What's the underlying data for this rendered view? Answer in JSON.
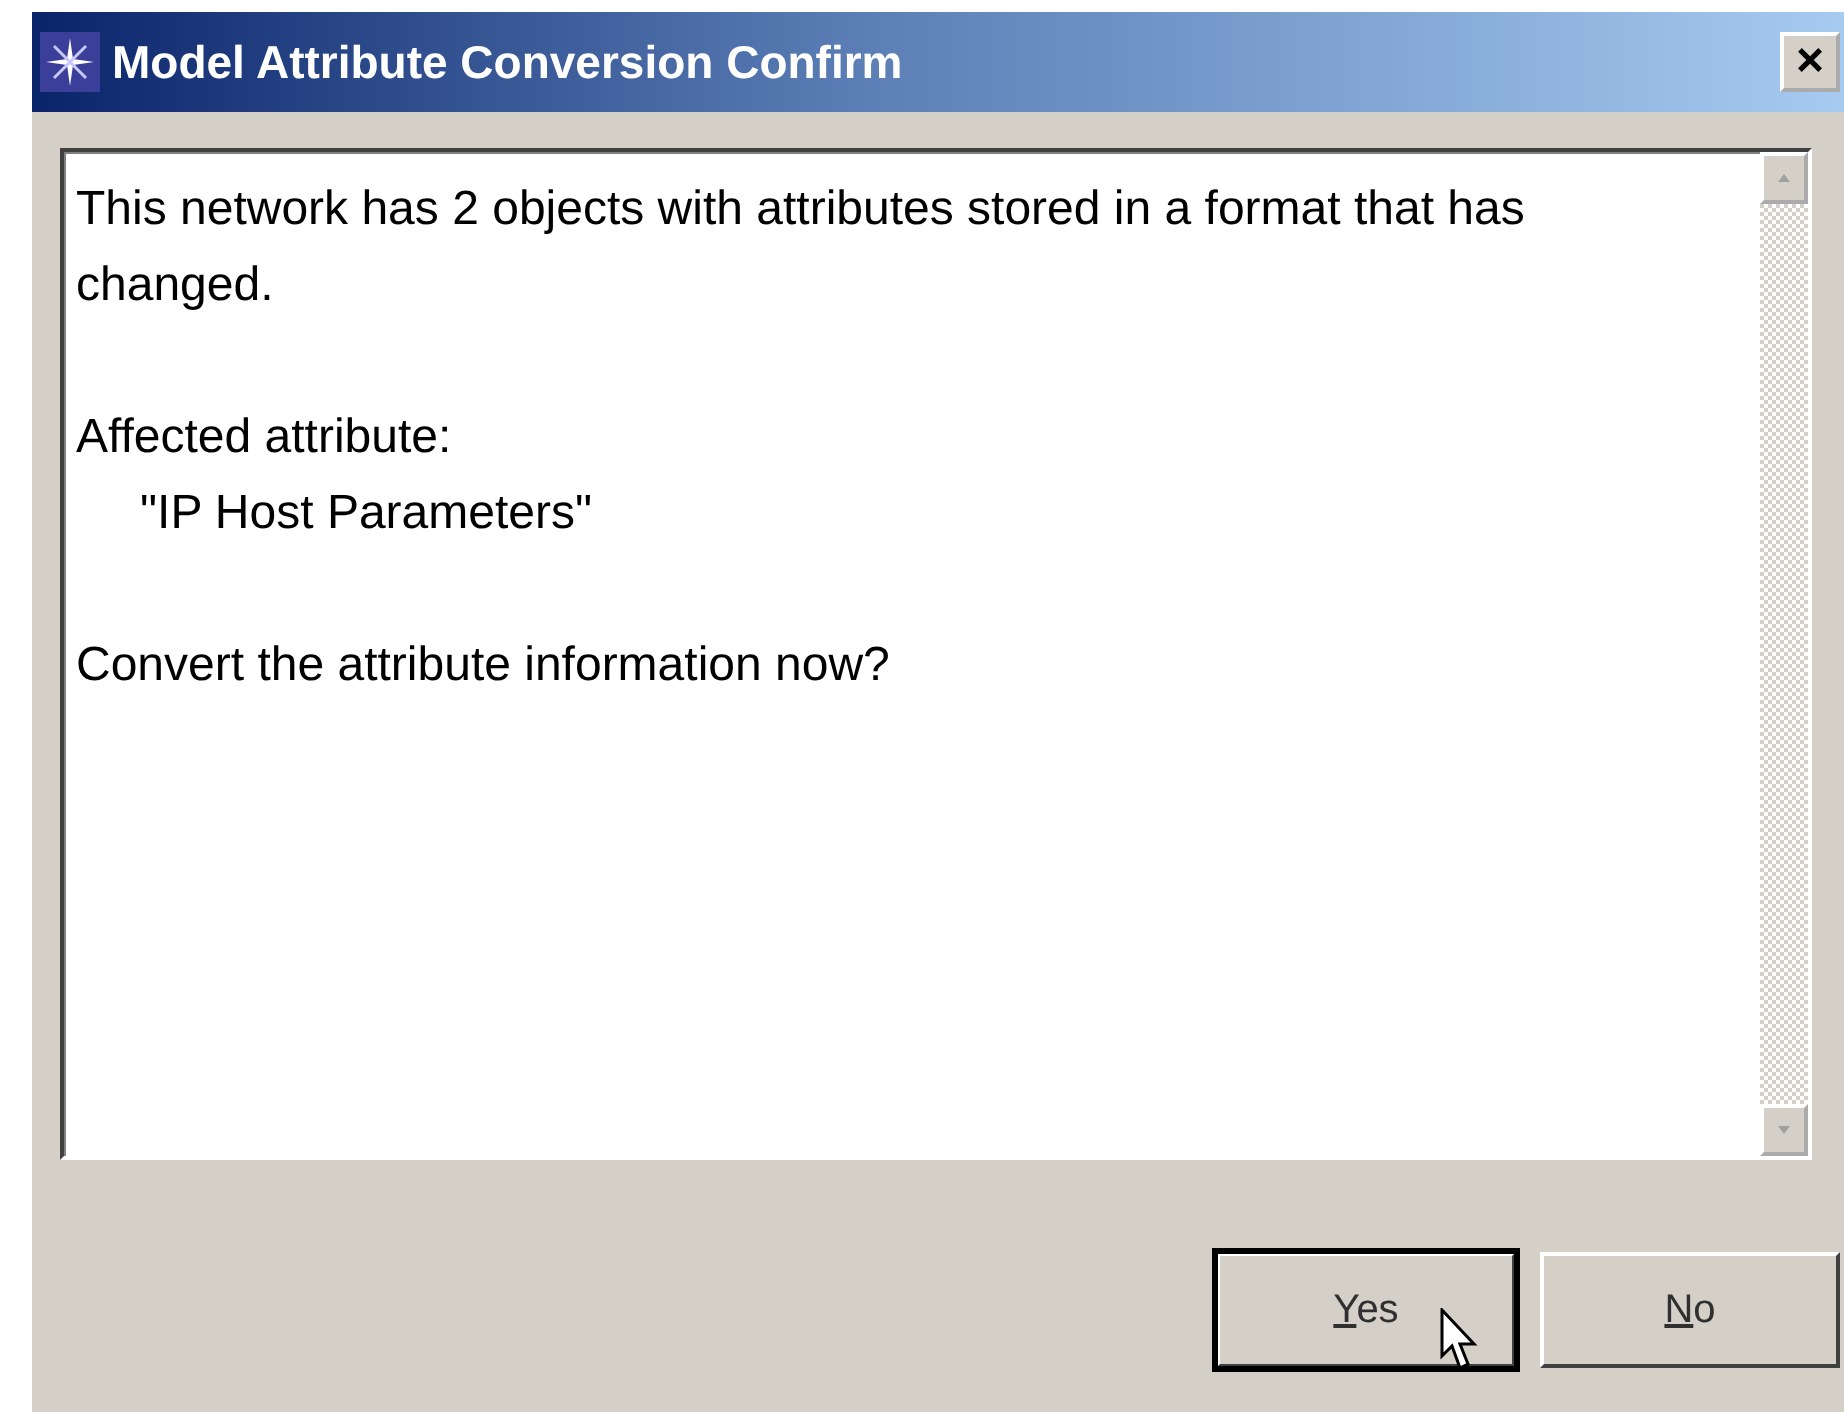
{
  "window": {
    "title": "Model Attribute Conversion Confirm",
    "close_label": "×"
  },
  "message": [
    {
      "kind": "paragraph",
      "text": "This network has 2 objects with attributes stored in a format that has changed."
    },
    {
      "kind": "paragraph",
      "text": "Affected attribute:"
    },
    {
      "kind": "indented",
      "text": "\"IP Host Parameters\""
    },
    {
      "kind": "paragraph",
      "text": "Convert the attribute information now?"
    }
  ],
  "buttons": [
    {
      "label": "Yes",
      "default": true
    },
    {
      "label": "No",
      "default": false
    }
  ]
}
